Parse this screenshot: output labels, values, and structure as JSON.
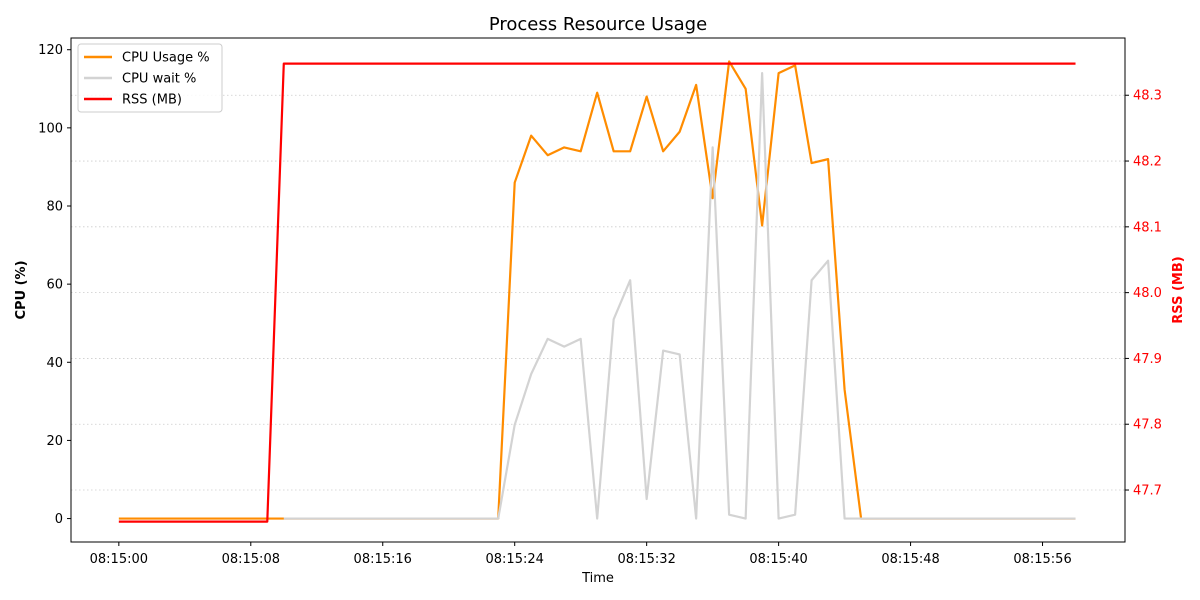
{
  "chart_data": {
    "type": "line",
    "title": "Process Resource Usage",
    "xlabel": "Time",
    "ylabel_left": "CPU (%)",
    "ylabel_right": "RSS (MB)",
    "x_ticks": [
      "08:15:00",
      "08:15:08",
      "08:15:16",
      "08:15:24",
      "08:15:32",
      "08:15:40",
      "08:15:48",
      "08:15:56"
    ],
    "x_tick_seconds": [
      0,
      8,
      16,
      24,
      32,
      40,
      48,
      56
    ],
    "x_range_seconds": [
      -2.9,
      61.0
    ],
    "y_left_ticks": [
      0,
      20,
      40,
      60,
      80,
      100,
      120
    ],
    "y_left_range": [
      -6,
      123
    ],
    "y_right_ticks": [
      "47.7",
      "47.8",
      "47.9",
      "48.0",
      "48.1",
      "48.2",
      "48.3"
    ],
    "y_right_range": [
      47.621,
      48.387
    ],
    "grid": "horizontal dotted",
    "legend_position": "upper-left",
    "colors": {
      "cpu": "#ff8c00",
      "wait": "#d3d3d3",
      "rss": "#ff0000"
    },
    "series": [
      {
        "name": "CPU Usage %",
        "axis": "left",
        "color": "#ff8c00",
        "points": [
          [
            0,
            0
          ],
          [
            1,
            0
          ],
          [
            2,
            0
          ],
          [
            3,
            0
          ],
          [
            4,
            0
          ],
          [
            5,
            0
          ],
          [
            6,
            0
          ],
          [
            7,
            0
          ],
          [
            8,
            0
          ],
          [
            9,
            0
          ],
          [
            10,
            0
          ],
          [
            11,
            0
          ],
          [
            12,
            0
          ],
          [
            13,
            0
          ],
          [
            14,
            0
          ],
          [
            15,
            0
          ],
          [
            16,
            0
          ],
          [
            17,
            0
          ],
          [
            18,
            0
          ],
          [
            19,
            0
          ],
          [
            20,
            0
          ],
          [
            21,
            0
          ],
          [
            22,
            0
          ],
          [
            23,
            0
          ],
          [
            24,
            86
          ],
          [
            25,
            98
          ],
          [
            26,
            93
          ],
          [
            27,
            95
          ],
          [
            28,
            94
          ],
          [
            29,
            109
          ],
          [
            30,
            94
          ],
          [
            31,
            94
          ],
          [
            32,
            108
          ],
          [
            33,
            94
          ],
          [
            34,
            99
          ],
          [
            35,
            111
          ],
          [
            36,
            82
          ],
          [
            37,
            117
          ],
          [
            38,
            110
          ],
          [
            39,
            75
          ],
          [
            40,
            114
          ],
          [
            41,
            116
          ],
          [
            42,
            91
          ],
          [
            43,
            92
          ],
          [
            44,
            33
          ],
          [
            45,
            0
          ],
          [
            46,
            0
          ],
          [
            47,
            0
          ],
          [
            48,
            0
          ],
          [
            49,
            0
          ],
          [
            50,
            0
          ],
          [
            51,
            0
          ],
          [
            52,
            0
          ],
          [
            53,
            0
          ],
          [
            54,
            0
          ],
          [
            55,
            0
          ],
          [
            56,
            0
          ],
          [
            57,
            0
          ],
          [
            58,
            0
          ]
        ]
      },
      {
        "name": "CPU wait %",
        "axis": "left",
        "color": "#d3d3d3",
        "points": [
          [
            10,
            0
          ],
          [
            11,
            0
          ],
          [
            12,
            0
          ],
          [
            13,
            0
          ],
          [
            14,
            0
          ],
          [
            15,
            0
          ],
          [
            16,
            0
          ],
          [
            17,
            0
          ],
          [
            18,
            0
          ],
          [
            19,
            0
          ],
          [
            20,
            0
          ],
          [
            21,
            0
          ],
          [
            22,
            0
          ],
          [
            23,
            0
          ],
          [
            24,
            24
          ],
          [
            25,
            37
          ],
          [
            26,
            46
          ],
          [
            27,
            44
          ],
          [
            28,
            46
          ],
          [
            29,
            0
          ],
          [
            30,
            51
          ],
          [
            31,
            61
          ],
          [
            32,
            5
          ],
          [
            33,
            43
          ],
          [
            34,
            42
          ],
          [
            35,
            0
          ],
          [
            36,
            95
          ],
          [
            37,
            1
          ],
          [
            38,
            0
          ],
          [
            39,
            114
          ],
          [
            40,
            0
          ],
          [
            41,
            1
          ],
          [
            42,
            61
          ],
          [
            43,
            66
          ],
          [
            44,
            0
          ],
          [
            45,
            0
          ],
          [
            46,
            0
          ],
          [
            47,
            0
          ],
          [
            48,
            0
          ],
          [
            49,
            0
          ],
          [
            50,
            0
          ],
          [
            51,
            0
          ],
          [
            52,
            0
          ],
          [
            53,
            0
          ],
          [
            54,
            0
          ],
          [
            55,
            0
          ],
          [
            56,
            0
          ],
          [
            57,
            0
          ],
          [
            58,
            0
          ]
        ]
      },
      {
        "name": "RSS (MB)",
        "axis": "right",
        "color": "#ff0000",
        "points": [
          [
            0,
            47.652
          ],
          [
            1,
            47.652
          ],
          [
            2,
            47.652
          ],
          [
            3,
            47.652
          ],
          [
            4,
            47.652
          ],
          [
            5,
            47.652
          ],
          [
            6,
            47.652
          ],
          [
            7,
            47.652
          ],
          [
            8,
            47.652
          ],
          [
            9,
            47.652
          ],
          [
            10,
            48.348
          ],
          [
            11,
            48.348
          ],
          [
            20,
            48.348
          ],
          [
            30,
            48.348
          ],
          [
            40,
            48.348
          ],
          [
            50,
            48.348
          ],
          [
            58,
            48.348
          ]
        ]
      }
    ]
  }
}
